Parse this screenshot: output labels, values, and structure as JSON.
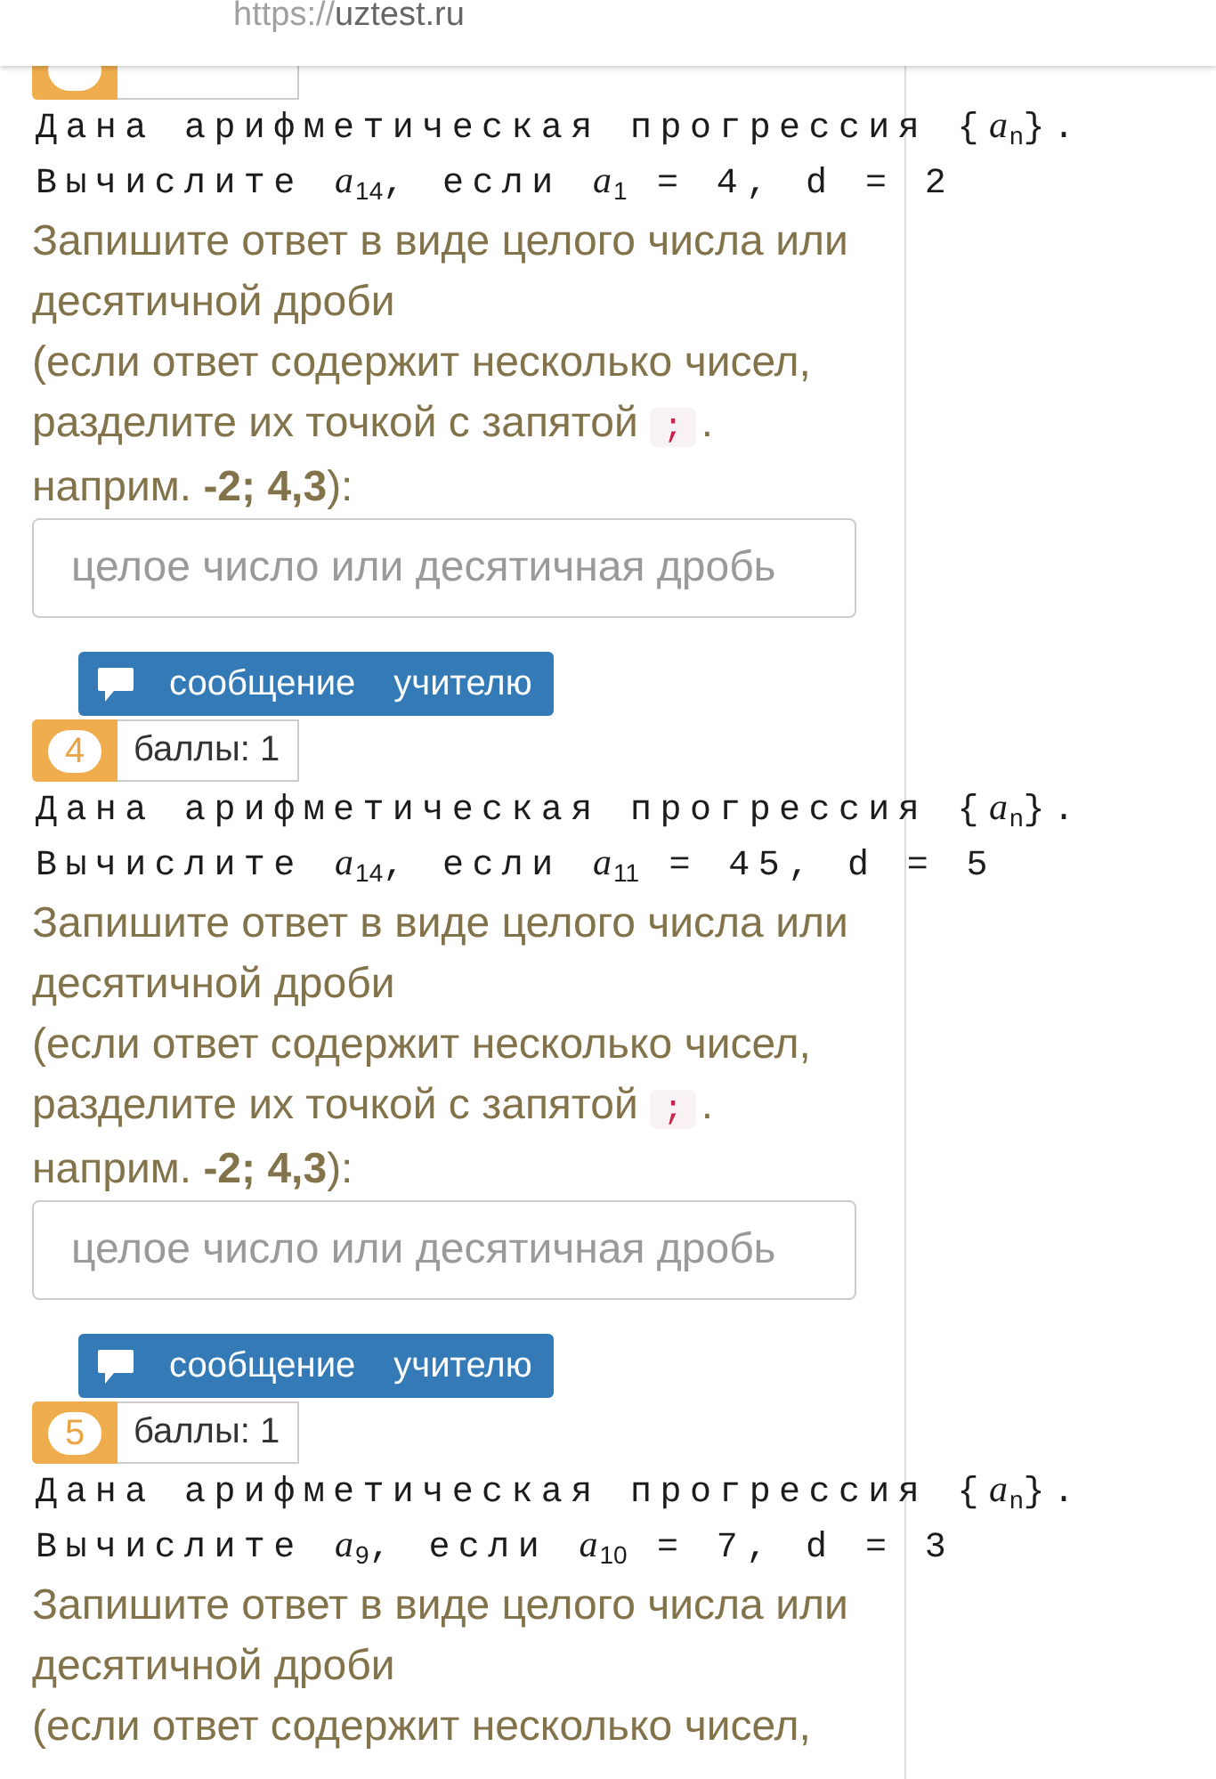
{
  "address_bar": {
    "url": {
      "scheme": "https://",
      "host": "uztest.ru"
    }
  },
  "questions": [
    {
      "statement": [
        "Дана арифметическая прогрессия {*a*$_{n}$}.",
        "Вычислите *a*$_{14}$, если *a*$_{1}$ = 4, d = 2"
      ],
      "instruction": "Запишите ответ в виде целого числа или десятичной дроби",
      "note": {
        "before": "(если ответ содержит несколько чисел, разделите их точкой с запятой",
        "code": ";",
        "after": "."
      },
      "example": "наприм. **-2; 4,3**):",
      "answer": {
        "placeholder": "целое число или десятичная дробь"
      },
      "message_button": "сообщение учителю"
    },
    {
      "number": "4",
      "points": "баллы: 1",
      "statement": [
        "Дана арифметическая прогрессия {*a*$_{n}$}.",
        "Вычислите *a*$_{14}$, если *a*$_{11}$ = 45, d = 5"
      ],
      "instruction": "Запишите ответ в виде целого числа или десятичной дроби",
      "note": {
        "before": "(если ответ содержит несколько чисел, разделите их точкой с запятой",
        "code": ";",
        "after": "."
      },
      "example": "наприм. **-2; 4,3**):",
      "answer": {
        "placeholder": "целое число или десятичная дробь"
      },
      "message_button": "сообщение учителю"
    },
    {
      "number": "5",
      "points": "баллы: 1",
      "statement": [
        "Дана арифметическая прогрессия {*a*$_{n}$}.",
        "Вычислите *a*$_{9}$, если *a*$_{10}$ = 7, d = 3"
      ],
      "instruction": "Запишите ответ в виде целого числа или десятичной дроби",
      "note": {
        "before": "(если ответ содержит несколько чисел,"
      }
    }
  ]
}
